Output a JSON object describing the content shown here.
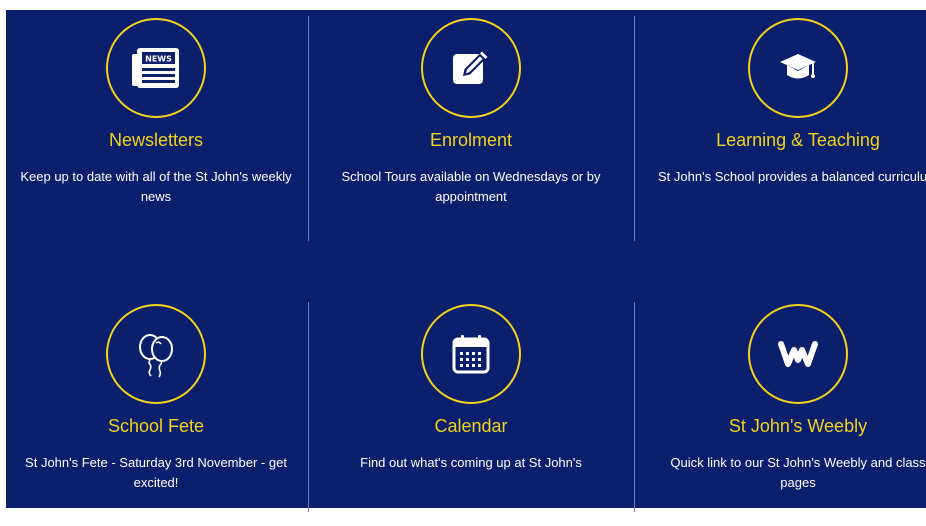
{
  "colors": {
    "panel_background": "#0c1f6d",
    "accent": "#f2d21b",
    "text": "#ffffff",
    "divider": "#6c7fb5"
  },
  "tiles": [
    {
      "title": "Newsletters",
      "description": "Keep up to date with all of the St John's weekly news",
      "icon": "newspaper-icon",
      "icon_text": "NEWS"
    },
    {
      "title": "Enrolment",
      "description": "School Tours available on Wednesdays or by appointment",
      "icon": "pencil-square-icon"
    },
    {
      "title": "Learning & Teaching",
      "description": "St John's School provides a balanced curriculum",
      "icon": "graduation-cap-icon"
    },
    {
      "title": "School Fete",
      "description": "St John's Fete - Saturday 3rd November - get excited!",
      "icon": "balloons-icon"
    },
    {
      "title": "Calendar",
      "description": "Find out what's coming up at St John's",
      "icon": "calendar-icon"
    },
    {
      "title": "St John's Weebly",
      "description": "Quick link to our St John's Weebly and class pages",
      "icon": "weebly-logo-icon"
    }
  ]
}
